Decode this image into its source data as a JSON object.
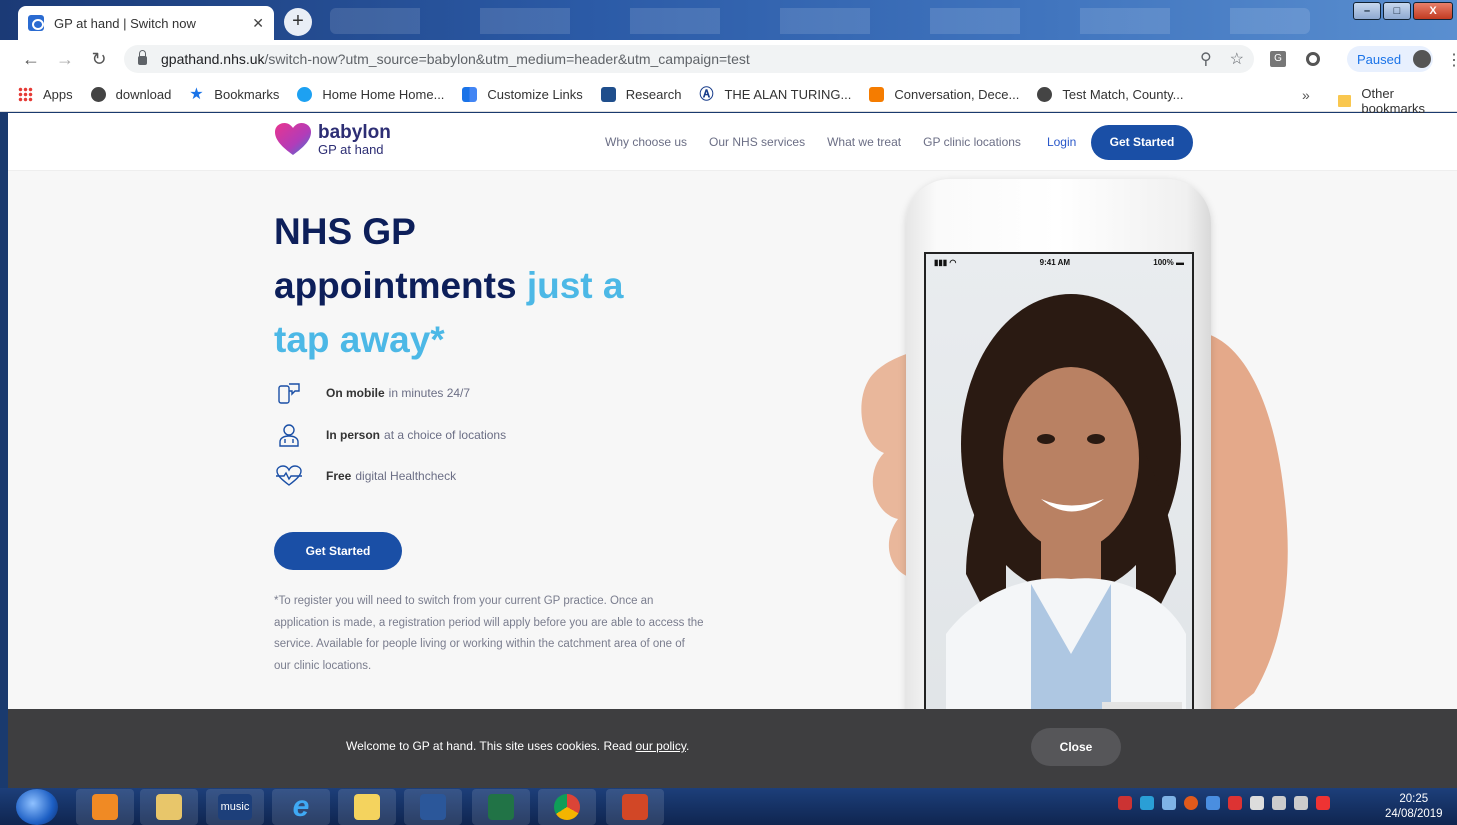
{
  "browser": {
    "tab_title": "GP at hand | Switch now",
    "tab_close": "✕",
    "new_tab": "+",
    "url_domain": "gpathand.nhs.uk",
    "url_path": "/switch-now?utm_source=babylon&utm_medium=header&utm_campaign=test",
    "profile_label": "Paused",
    "extension_label": "G",
    "bookmarks": [
      {
        "label": "Apps",
        "icon": "apps-grid-icon"
      },
      {
        "label": "download",
        "icon": "globe-icon"
      },
      {
        "label": "Bookmarks",
        "icon": "star-icon"
      },
      {
        "label": "Home Home Home...",
        "icon": "twitter-icon"
      },
      {
        "label": "Customize Links",
        "icon": "windows-icon"
      },
      {
        "label": "Research",
        "icon": "calendar-icon"
      },
      {
        "label": "THE ALAN TURING...",
        "icon": "turing-icon"
      },
      {
        "label": "Conversation, Dece...",
        "icon": "blogger-icon"
      },
      {
        "label": "Test Match, County...",
        "icon": "globe-icon"
      }
    ],
    "bookmarks_more": "»",
    "other_bookmarks": "Other bookmarks"
  },
  "site": {
    "logo_brand": "babylon",
    "logo_sub": "GP at hand",
    "nav": [
      "Why choose us",
      "Our NHS services",
      "What we treat",
      "GP clinic locations"
    ],
    "login": "Login",
    "header_cta": "Get Started"
  },
  "hero": {
    "title_line1": "NHS GP",
    "title_line2_a": "appointments",
    "title_line2_b": "just a",
    "title_line3": "tap away*",
    "features": [
      {
        "bold": "On mobile",
        "text": "in minutes 24/7",
        "icon": "mobile-chat-icon"
      },
      {
        "bold": "In person",
        "text": "at a choice of locations",
        "icon": "doctor-icon"
      },
      {
        "bold": "Free",
        "text": "digital Healthcheck",
        "icon": "heart-pulse-icon"
      }
    ],
    "cta": "Get Started",
    "disclaimer": "*To register you will need to switch from your current GP practice. Once an application is made, a registration period will apply before you are able to access the service. Available for people living or working within the catchment area of one of our clinic locations."
  },
  "phone": {
    "time": "9:41 AM",
    "battery": "100%"
  },
  "cookie": {
    "message": "Welcome to GP at hand. This site uses cookies. Read ",
    "link": "our policy",
    "end": ".",
    "close": "Close"
  },
  "taskbar": {
    "apps": [
      "media-player-icon",
      "file-explorer-icon",
      "amazon-music-icon",
      "internet-explorer-icon",
      "sticky-notes-icon",
      "word-icon",
      "excel-icon",
      "chrome-icon",
      "powerpoint-icon"
    ],
    "music_label": "music",
    "time": "20:25",
    "date": "24/08/2019"
  },
  "colors": {
    "primary": "#1a4fa6",
    "title": "#0d1f5a",
    "accent": "#4cb8e6",
    "cookie_bg": "#3e3e40"
  }
}
